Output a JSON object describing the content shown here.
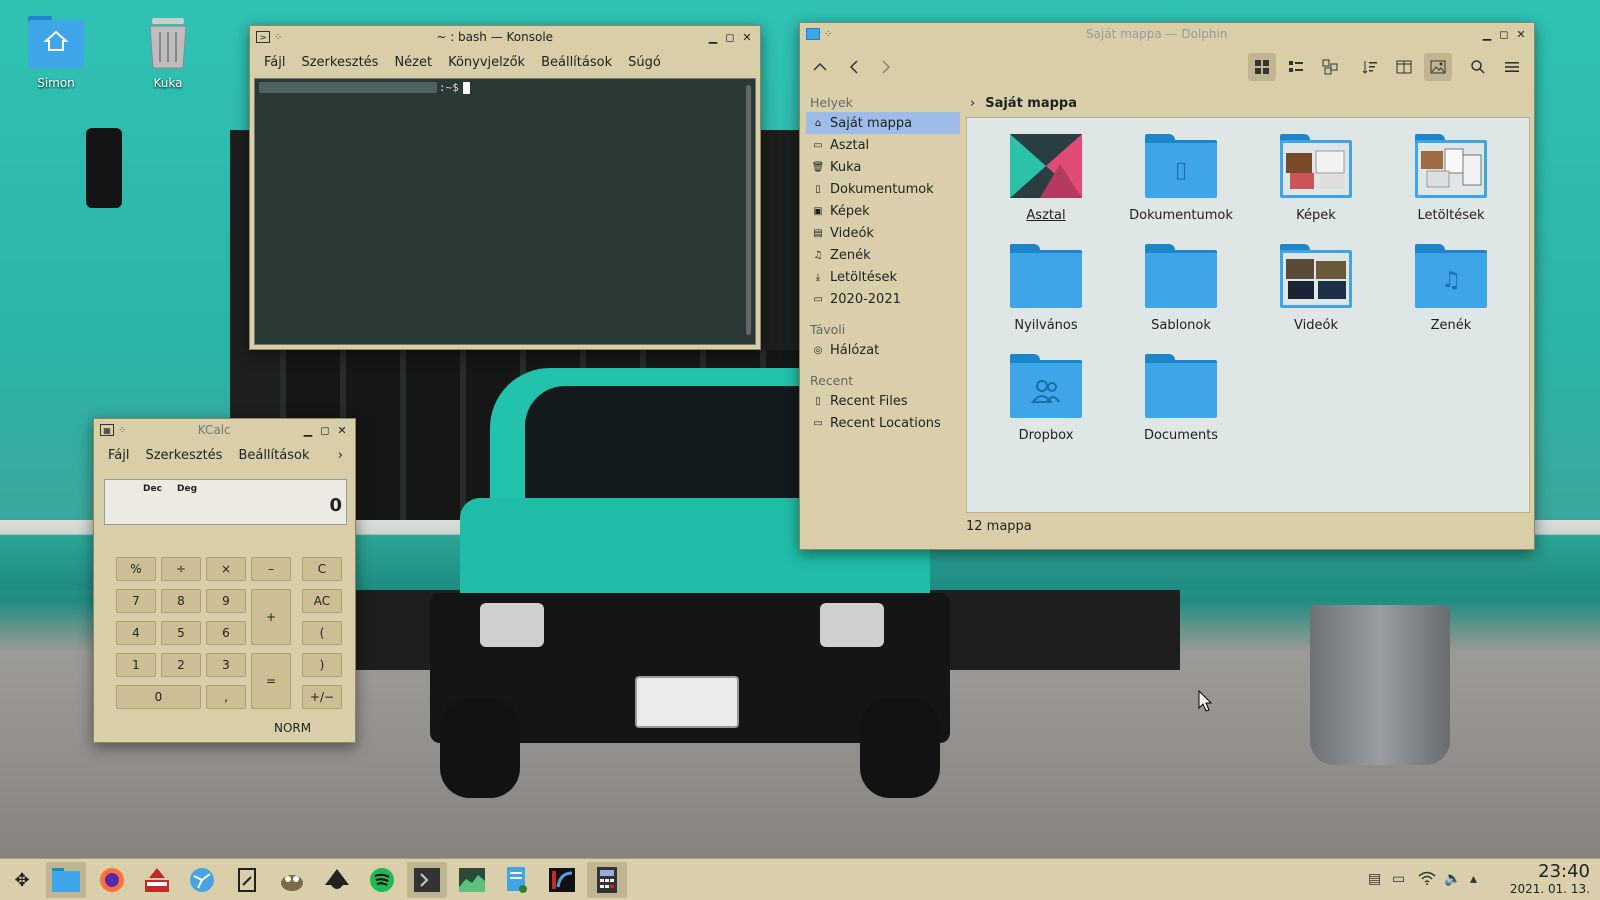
{
  "desktop": {
    "icons": [
      {
        "label": "Simon",
        "icon": "home-folder-icon"
      },
      {
        "label": "Kuka",
        "icon": "trash-icon"
      }
    ]
  },
  "konsole": {
    "title": "~ : bash — Konsole",
    "menu": [
      "Fájl",
      "Szerkesztés",
      "Nézet",
      "Könyvjelzők",
      "Beállítások",
      "Súgó"
    ],
    "prompt_suffix": ":~$"
  },
  "kcalc": {
    "title": "KCalc",
    "menu": [
      "Fájl",
      "Szerkesztés",
      "Beállítások"
    ],
    "mode_base": "Dec",
    "mode_angle": "Deg",
    "display": "0",
    "buttons": {
      "percent": "%",
      "divide": "÷",
      "multiply": "×",
      "minus": "–",
      "clear": "C",
      "seven": "7",
      "eight": "8",
      "nine": "9",
      "plus": "+",
      "all_clear": "AC",
      "four": "4",
      "five": "5",
      "six": "6",
      "open_paren": "(",
      "one": "1",
      "two": "2",
      "three": "3",
      "equals": "=",
      "close_paren": ")",
      "zero": "0",
      "comma": ",",
      "sign": "+/−"
    },
    "status": "NORM"
  },
  "dolphin": {
    "title": "Saját mappa — Dolphin",
    "places_header": "Helyek",
    "places": [
      "Saját mappa",
      "Asztal",
      "Kuka",
      "Dokumentumok",
      "Képek",
      "Videók",
      "Zenék",
      "Letöltések",
      "2020-2021"
    ],
    "remote_header": "Távoli",
    "remote": [
      "Hálózat"
    ],
    "recent_header": "Recent",
    "recent": [
      "Recent Files",
      "Recent Locations"
    ],
    "breadcrumb": "Saját mappa",
    "folders": [
      "Asztal",
      "Dokumentumok",
      "Képek",
      "Letöltések",
      "Nyilvános",
      "Sablonok",
      "Videók",
      "Zenék",
      "Dropbox",
      "Documents"
    ],
    "status": "12 mappa"
  },
  "taskbar": {
    "time": "23:40",
    "date": "2021. 01. 13."
  },
  "colors": {
    "window_bg": "#d8cfa9",
    "selection": "#9ebce8",
    "folder_blue": "#3da5e8"
  }
}
